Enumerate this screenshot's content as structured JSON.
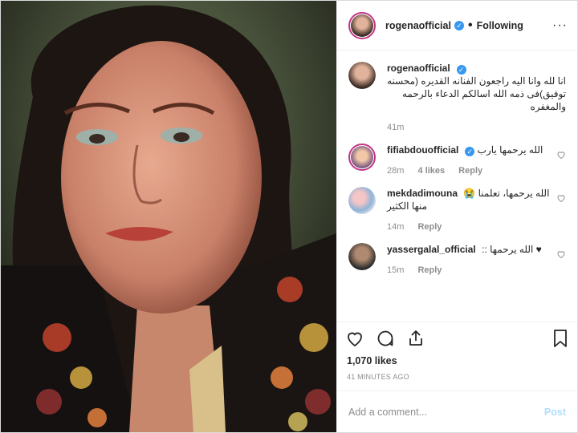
{
  "header": {
    "username": "rogenaofficial",
    "separator": "•",
    "follow_label": "Following",
    "more_label": "···",
    "colors": {
      "verified": "#3897f0",
      "story_ring": "#c13584"
    }
  },
  "caption": {
    "username": "rogenaofficial",
    "text": "انا لله وانا اليه راجعون الفنانه القديره (محسنه توفيق)فى ذمه الله اسالكم الدعاء بالرحمه والمغفره",
    "time": "41m"
  },
  "comments": [
    {
      "username": "fifiabdouofficial",
      "text": "الله يرحمها يارب",
      "time": "28m",
      "likes": "4 likes",
      "reply": "Reply",
      "verified": true
    },
    {
      "username": "mekdadimouna",
      "text": "الله يرحمها، تعلمنا 😭 منها الكثير",
      "time": "14m",
      "likes": "",
      "reply": "Reply",
      "verified": false
    },
    {
      "username": "yassergalal_official",
      "text": "♥ الله يرحمها ::",
      "time": "15m",
      "likes": "",
      "reply": "Reply",
      "verified": false
    }
  ],
  "actions": {
    "icons": [
      "heart-icon",
      "comment-icon",
      "share-icon",
      "bookmark-icon"
    ]
  },
  "likes": "1,070 likes",
  "posted_ago": "41 MINUTES AGO",
  "add_comment": {
    "placeholder": "Add a comment...",
    "post_label": "Post"
  }
}
